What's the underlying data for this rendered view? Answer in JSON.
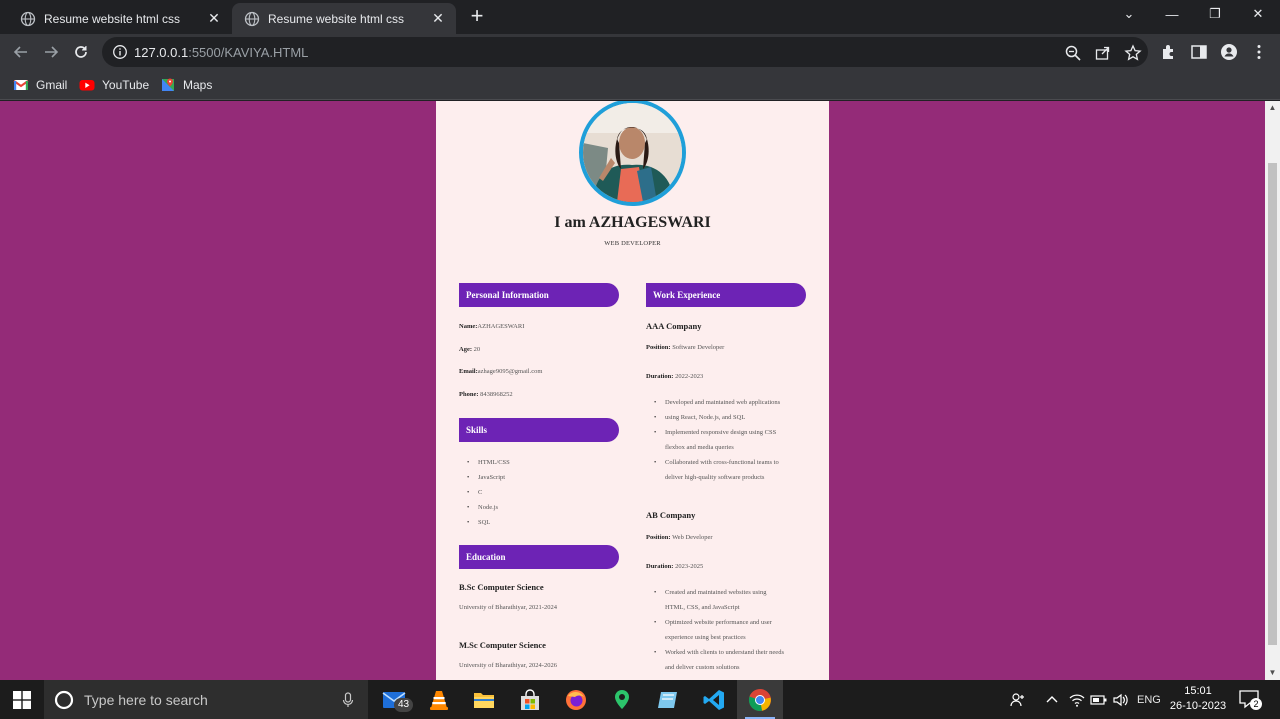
{
  "browser": {
    "tabs": [
      {
        "title": "Resume website html css",
        "active": false
      },
      {
        "title": "Resume website html css",
        "active": true
      }
    ],
    "url_host": "127.0.0.1",
    "url_rest": ":5500/KAVIYA.HTML",
    "bookmarks": [
      {
        "label": "Gmail",
        "icon": "gmail-icon"
      },
      {
        "label": "YouTube",
        "icon": "youtube-icon"
      },
      {
        "label": "Maps",
        "icon": "maps-icon"
      }
    ]
  },
  "resume": {
    "page_bg": "#942b78",
    "card_bg": "#fdeeee",
    "accent": "#6d23b5",
    "heading": "I am AZHAGESWARI",
    "role": "WEB DEVELOPER",
    "personal": {
      "title": "Personal Information",
      "name_label": "Name:",
      "name_value": "AZHAGESWARI",
      "age_label": "Age:",
      "age_value": " 20",
      "email_label": "Email:",
      "email_value": "azhage9095@gmail.com",
      "phone_label": "Phone:",
      "phone_value": " 8438968252"
    },
    "skills": {
      "title": "Skills",
      "items": [
        "HTML/CSS",
        "JavaScript",
        "C",
        "Node.js",
        "SQL"
      ]
    },
    "education": {
      "title": "Education",
      "items": [
        {
          "degree": "B.Sc Computer Science",
          "detail": "University of Bharathiyar, 2021-2024"
        },
        {
          "degree": "M.Sc Computer Science",
          "detail": "University of Bharathiyar, 2024-2026"
        }
      ]
    },
    "work": {
      "title": "Work Experience",
      "jobs": [
        {
          "company": "AAA Company",
          "position_label": "Position:",
          "position": " Software Developer",
          "duration_label": "Duration:",
          "duration": " 2022-2023",
          "bullets": [
            "Developed and maintained web applications",
            "using React, Node.js, and SQL",
            "Implemented responsive design using CSS",
            "flexbox and media queries",
            "Collaborated with cross-functional teams to",
            "deliver high-quality software products"
          ]
        },
        {
          "company": "AB Company",
          "position_label": "Position:",
          "position": " Web Developer",
          "duration_label": "Duration:",
          "duration": " 2023-2025",
          "bullets": [
            "Created and maintained websites using",
            "HTML, CSS, and JavaScript",
            "Optimized website performance and user",
            "experience using best practices",
            "Worked with clients to understand their needs",
            "and deliver custom solutions"
          ]
        }
      ]
    }
  },
  "taskbar": {
    "search_placeholder": "Type here to search",
    "mail_badge": "43",
    "language": "ENG",
    "time": "15:01",
    "date": "26-10-2023",
    "notification_count": "2"
  }
}
